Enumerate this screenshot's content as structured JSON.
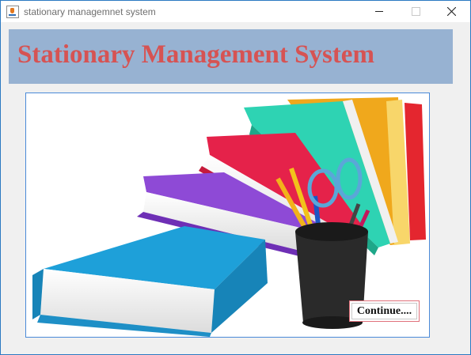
{
  "window": {
    "title": "stationary managemnet system"
  },
  "header": {
    "title": "Stationary Management System"
  },
  "main": {
    "continue_label": "Continue...."
  },
  "colors": {
    "banner": "#97b2d2",
    "title_text": "#d65353",
    "panel_border": "#4a8ad8"
  }
}
